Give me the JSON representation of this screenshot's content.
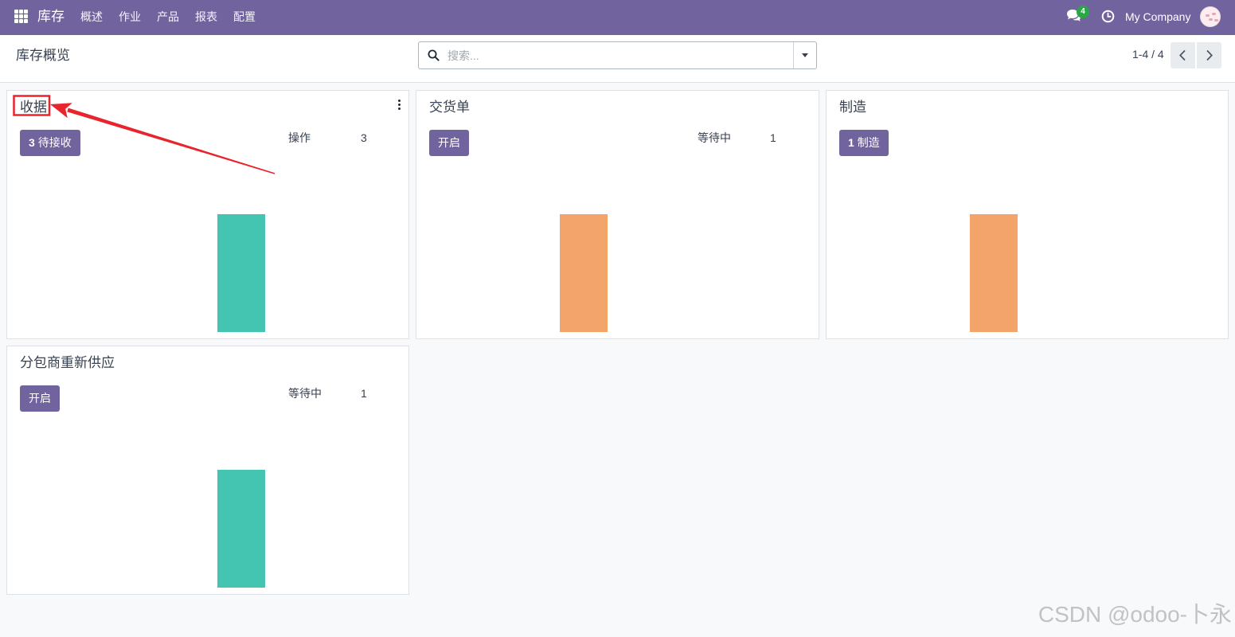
{
  "navbar": {
    "app_name": "库存",
    "menu": [
      {
        "label": "概述"
      },
      {
        "label": "作业"
      },
      {
        "label": "产品"
      },
      {
        "label": "报表"
      },
      {
        "label": "配置"
      }
    ],
    "messages_badge": "4",
    "company": "My Company"
  },
  "control_panel": {
    "breadcrumb": "库存概览",
    "search_placeholder": "搜索...",
    "pager": "1-4 / 4"
  },
  "cards": [
    {
      "title": "收据",
      "button": {
        "count": "3",
        "label": "待接收"
      },
      "stat": {
        "label": "操作",
        "value": "3"
      },
      "graph": {
        "color": "#43c5b2",
        "levels": [
          0,
          0,
          0,
          0.7,
          0,
          0
        ]
      }
    },
    {
      "title": "交货单",
      "button": {
        "label": "开启"
      },
      "stat": {
        "label": "等待中",
        "value": "1"
      },
      "graph": {
        "color": "#f3a46a",
        "levels": [
          0,
          0,
          0.7,
          0,
          0,
          0
        ]
      }
    },
    {
      "title": "制造",
      "button": {
        "count": "1",
        "label": "制造"
      },
      "graph": {
        "color": "#f3a46a",
        "levels": [
          0,
          0,
          0.7,
          0,
          0,
          0
        ]
      }
    },
    {
      "title": "分包商重新供应",
      "button": {
        "label": "开启"
      },
      "stat": {
        "label": "等待中",
        "value": "1"
      },
      "graph": {
        "color": "#43c5b2",
        "levels": [
          0,
          0,
          0,
          0.7,
          0,
          0
        ]
      }
    }
  ],
  "watermark": "CSDN @odoo-卜永",
  "colors": {
    "brand": "#71639e",
    "badge": "#28a745",
    "teal": "#43c5b2",
    "orange": "#f3a46a",
    "annotation": "#e8242c"
  },
  "icons": {
    "apps": "apps-grid-icon",
    "messages": "chat-icon",
    "activities": "clock-icon",
    "search": "search-icon",
    "search_toggle": "caret-down-icon",
    "prev": "chevron-left-icon",
    "next": "chevron-right-icon",
    "card_menu": "kebab-menu-icon"
  }
}
